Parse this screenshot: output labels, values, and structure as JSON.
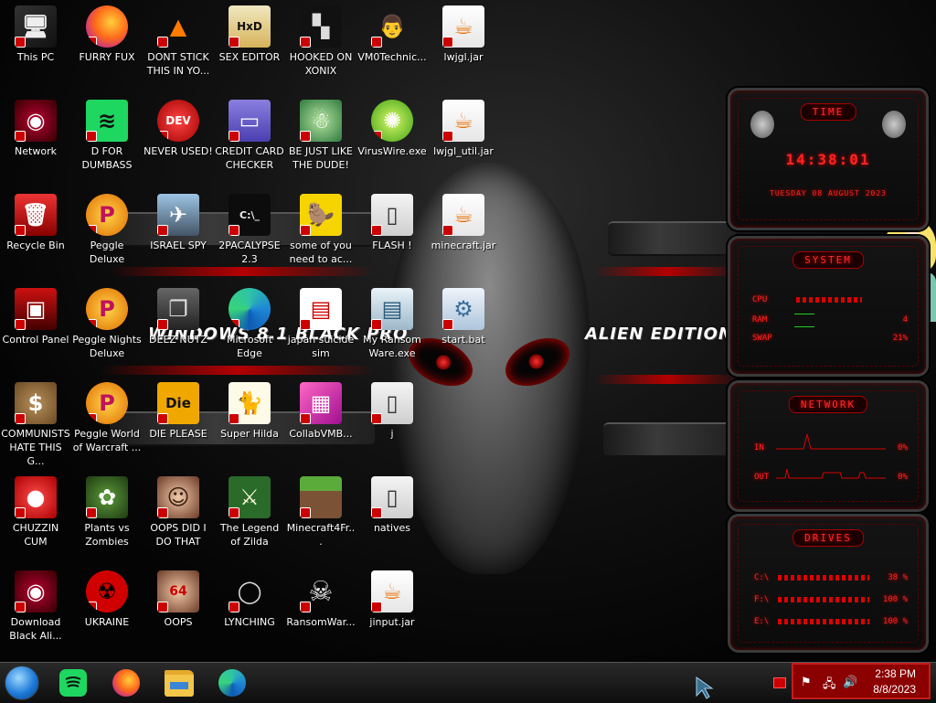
{
  "wallpaper": {
    "left_text": "WINDOWS 8.1 BLACK PRO",
    "right_text": "ALIEN EDITION 20"
  },
  "icons": [
    {
      "label": "This PC",
      "icon": "computer-icon",
      "col": 0,
      "row": 0
    },
    {
      "label": "Network",
      "icon": "alien-network-icon",
      "col": 0,
      "row": 1
    },
    {
      "label": "Recycle Bin",
      "icon": "recycle-bin-icon",
      "col": 0,
      "row": 2
    },
    {
      "label": "Control Panel",
      "icon": "control-panel-icon",
      "col": 0,
      "row": 3
    },
    {
      "label": "COMMUNISTS HATE THIS G...",
      "icon": "money-bag-icon",
      "col": 0,
      "row": 4
    },
    {
      "label": "CHUZZIN CUM",
      "icon": "chuzzle-icon",
      "col": 0,
      "row": 5
    },
    {
      "label": "Download Black Ali...",
      "icon": "alien-download-icon",
      "col": 0,
      "row": 6
    },
    {
      "label": "FURRY FUX",
      "icon": "firefox-icon",
      "col": 1,
      "row": 0
    },
    {
      "label": "D FOR DUMBASS",
      "icon": "spotify-icon",
      "col": 1,
      "row": 1
    },
    {
      "label": "Peggle Deluxe",
      "icon": "peggle-icon",
      "col": 1,
      "row": 2
    },
    {
      "label": "Peggle Nights Deluxe",
      "icon": "peggle-icon",
      "col": 1,
      "row": 3
    },
    {
      "label": "Peggle World of Warcraft ...",
      "icon": "peggle-icon",
      "col": 1,
      "row": 4
    },
    {
      "label": "Plants vs Zombies",
      "icon": "pvz-icon",
      "col": 1,
      "row": 5
    },
    {
      "label": "UKRAINE",
      "icon": "radiation-icon",
      "col": 1,
      "row": 6
    },
    {
      "label": "DONT STICK THIS IN YO...",
      "icon": "vlc-icon",
      "col": 2,
      "row": 0
    },
    {
      "label": "NEVER USED!",
      "icon": "devcpp-icon",
      "col": 2,
      "row": 1
    },
    {
      "label": "ISRAEL SPY",
      "icon": "spy-icon",
      "col": 2,
      "row": 2
    },
    {
      "label": "DEEZ NUTZ",
      "icon": "stacked-windows-icon",
      "col": 2,
      "row": 3
    },
    {
      "label": "DIE PLEASE",
      "icon": "die-icon",
      "col": 2,
      "row": 4
    },
    {
      "label": "OOPS DID I DO THAT",
      "icon": "portrait-icon",
      "col": 2,
      "row": 5
    },
    {
      "label": "OOPS",
      "icon": "portrait-64-icon",
      "col": 2,
      "row": 6
    },
    {
      "label": "SEX EDITOR",
      "icon": "hxd-icon",
      "col": 3,
      "row": 0
    },
    {
      "label": "CREDIT CARD CHECKER",
      "icon": "credit-card-icon",
      "col": 3,
      "row": 1
    },
    {
      "label": "2PACALYPSE 2.3",
      "icon": "terminal-icon",
      "col": 3,
      "row": 2
    },
    {
      "label": "Microsoft Edge",
      "icon": "edge-icon",
      "col": 3,
      "row": 3
    },
    {
      "label": "Super Hilda",
      "icon": "pixel-cat-icon",
      "col": 3,
      "row": 4
    },
    {
      "label": "The Legend of Zilda",
      "icon": "zelda-icon",
      "col": 3,
      "row": 5
    },
    {
      "label": "LYNCHING",
      "icon": "noose-icon",
      "col": 3,
      "row": 6
    },
    {
      "label": "HOOKED ON XONIX",
      "icon": "xonix-icon",
      "col": 4,
      "row": 0
    },
    {
      "label": "BE JUST LIKE THE DUDE!",
      "icon": "elf-icon",
      "col": 4,
      "row": 1
    },
    {
      "label": "some of you need to ac...",
      "icon": "beaver-icon",
      "col": 4,
      "row": 2
    },
    {
      "label": "japan suicide sim",
      "icon": "file-icon",
      "col": 4,
      "row": 3
    },
    {
      "label": "CollabVMB...",
      "icon": "colored-cards-icon",
      "col": 4,
      "row": 4
    },
    {
      "label": "Minecraft4Fr...",
      "icon": "minecraft-block-icon",
      "col": 4,
      "row": 5
    },
    {
      "label": "RansomWar...",
      "icon": "skull-icon",
      "col": 4,
      "row": 6
    },
    {
      "label": "VM0Technic...",
      "icon": "doctor-icon",
      "col": 5,
      "row": 0
    },
    {
      "label": "VirusWire.exe",
      "icon": "lime-icon",
      "col": 5,
      "row": 1
    },
    {
      "label": "FLASH !",
      "icon": "document-icon",
      "col": 5,
      "row": 2
    },
    {
      "label": "My Ransom Ware.exe",
      "icon": "window-app-icon",
      "col": 5,
      "row": 3
    },
    {
      "label": "j",
      "icon": "document-icon",
      "col": 5,
      "row": 4
    },
    {
      "label": "natives",
      "icon": "document-icon",
      "col": 5,
      "row": 5
    },
    {
      "label": "jinput.jar",
      "icon": "java-icon",
      "col": 5,
      "row": 6
    },
    {
      "label": "lwjgl.jar",
      "icon": "java-icon",
      "col": 6,
      "row": 0
    },
    {
      "label": "lwjgl_util.jar",
      "icon": "java-icon",
      "col": 6,
      "row": 1
    },
    {
      "label": "minecraft.jar",
      "icon": "java-icon",
      "col": 6,
      "row": 2
    },
    {
      "label": "start.bat",
      "icon": "batch-gear-icon",
      "col": 6,
      "row": 3
    }
  ],
  "gadgets": {
    "time": {
      "title": "TIME",
      "clock": "14:38:01",
      "date": "TUESDAY 08 AUGUST 2023"
    },
    "system": {
      "title": "SYSTEM",
      "cpu_label": "CPU",
      "ram_label": "RAM",
      "swap_label": "SWAP",
      "ram_value": "4",
      "swap_value": "21%"
    },
    "network": {
      "title": "NETWORK",
      "in_label": "IN",
      "out_label": "OUT",
      "in_value": "0%",
      "out_value": "0%"
    },
    "drives": {
      "title": "DRIVES",
      "rows": [
        {
          "label": "C:\\",
          "value": "38 %"
        },
        {
          "label": "F:\\",
          "value": "100 %"
        },
        {
          "label": "E:\\",
          "value": "100 %"
        }
      ]
    }
  },
  "taskbar": {
    "buttons": [
      {
        "name": "start-orb-button",
        "icon": "windows-orb-icon"
      },
      {
        "name": "taskbar-spotify-button",
        "icon": "spotify-icon"
      },
      {
        "name": "taskbar-firefox-button",
        "icon": "firefox-icon"
      },
      {
        "name": "taskbar-file-explorer-button",
        "icon": "folder-icon"
      },
      {
        "name": "taskbar-edge-button",
        "icon": "edge-icon"
      }
    ],
    "clock_time": "2:38 PM",
    "clock_date": "8/8/2023"
  },
  "colors": {
    "accent_red": "#ff2323",
    "tray_red": "#8b0000",
    "java_orange": "#e76f00"
  }
}
